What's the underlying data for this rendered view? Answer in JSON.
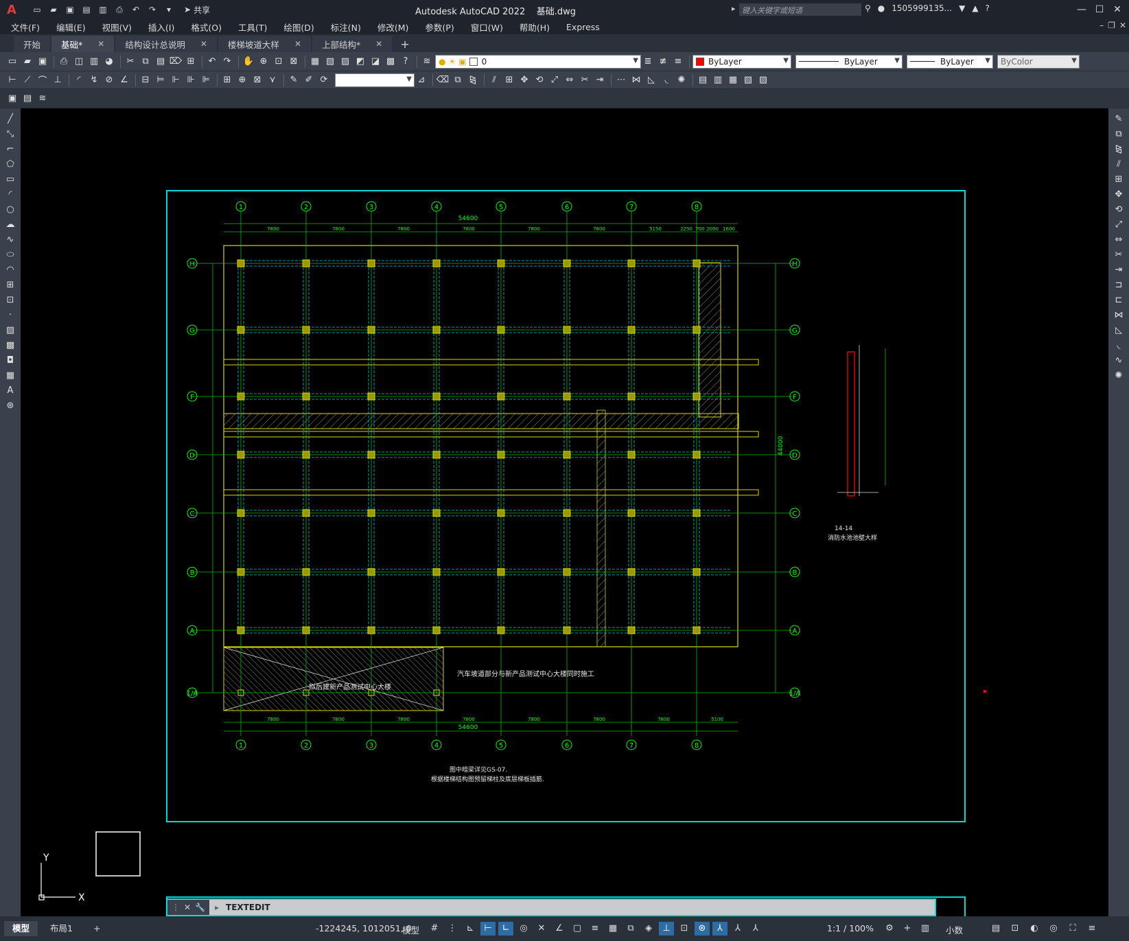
{
  "app": {
    "logo": "A",
    "title": "Autodesk AutoCAD 2022    基础.dwg",
    "share": "共享",
    "search_placeholder": "键入关键字或短语",
    "user": "1505999135...",
    "help": "?"
  },
  "menu": [
    "文件(F)",
    "编辑(E)",
    "视图(V)",
    "插入(I)",
    "格式(O)",
    "工具(T)",
    "绘图(D)",
    "标注(N)",
    "修改(M)",
    "参数(P)",
    "窗口(W)",
    "帮助(H)",
    "Express"
  ],
  "tabs": [
    {
      "label": "开始",
      "closable": false,
      "active": false
    },
    {
      "label": "基础*",
      "closable": true,
      "active": true
    },
    {
      "label": "结构设计总说明",
      "closable": true,
      "active": false
    },
    {
      "label": "楼梯坡道大样",
      "closable": true,
      "active": false
    },
    {
      "label": "上部结构*",
      "closable": true,
      "active": false
    }
  ],
  "layer_combo": {
    "value": "0"
  },
  "props": {
    "color": "ByLayer",
    "color_hex": "#ff0000",
    "linetype": "ByLayer",
    "lineweight": "ByLayer",
    "plotstyle": "ByColor"
  },
  "drawing": {
    "grid_cols": [
      "1",
      "2",
      "3",
      "4",
      "5",
      "6",
      "7",
      "8"
    ],
    "grid_rows": [
      "H",
      "G",
      "F",
      "D",
      "C",
      "B",
      "A",
      "1/A"
    ],
    "total_dim": "54600",
    "col_spacings": [
      "7800",
      "7800",
      "7800",
      "7800",
      "7800",
      "7800",
      "5150",
      "2250",
      "700",
      "2000",
      "1600"
    ],
    "bottom_spacings": [
      "7800",
      "7800",
      "7800",
      "7800",
      "7800",
      "7800",
      "7800",
      "5100"
    ],
    "right_total": "44000",
    "note_ramp": "汽车坡道部分与新产品测试中心大楼同时施工",
    "note_zone": "拟后建新产品测试中心大楼",
    "notes": [
      "图中暗梁详见GS-07.",
      "根据楼梯结构图预留梯柱及底层梯板插筋."
    ],
    "detail_title": "14-14",
    "detail_subtitle": "消防水池池壁大样"
  },
  "command": {
    "text": "TEXTEDIT"
  },
  "status": {
    "layout_tabs": [
      "模型",
      "布局1"
    ],
    "coords": "-1224245, 1012051, 0",
    "space": "模型",
    "scale": "1:1 / 100%",
    "units": "小数"
  },
  "ucs": {
    "x": "X",
    "y": "Y"
  }
}
